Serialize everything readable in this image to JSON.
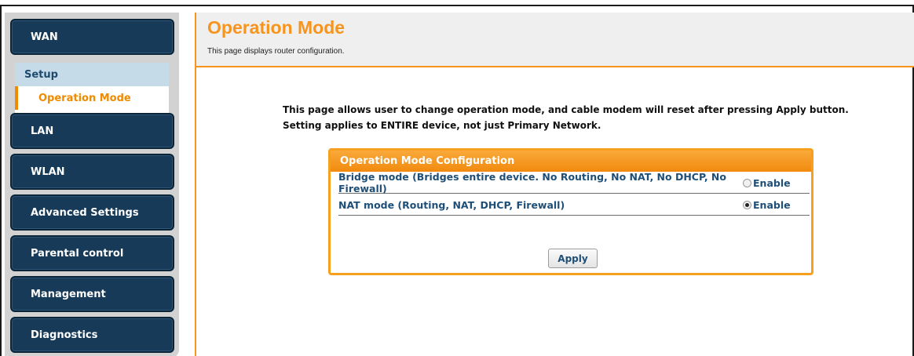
{
  "sidebar": {
    "items": [
      {
        "label": "WAN"
      },
      {
        "label": "LAN"
      },
      {
        "label": "WLAN"
      },
      {
        "label": "Advanced Settings"
      },
      {
        "label": "Parental control"
      },
      {
        "label": "Management"
      },
      {
        "label": "Diagnostics"
      }
    ],
    "submenu": {
      "setup": "Setup",
      "operation_mode": "Operation Mode"
    }
  },
  "header": {
    "title": "Operation Mode",
    "subtitle": "This page displays router configuration."
  },
  "description": {
    "line1": "This page allows user to change operation mode, and cable modem will reset after pressing Apply button.",
    "line2": "Setting applies to ENTIRE device, not just Primary Network."
  },
  "panel": {
    "title": "Operation Mode Configuration",
    "rows": [
      {
        "label": "Bridge mode (Bridges entire device. No Routing, No NAT, No DHCP, No Firewall)",
        "option": "Enable",
        "checked": false
      },
      {
        "label": "NAT mode (Routing, NAT, DHCP, Firewall)",
        "option": "Enable",
        "checked": true
      }
    ],
    "apply_label": "Apply"
  },
  "colors": {
    "accent": "#f7941d",
    "nav": "#163a57",
    "link": "#1e4f78"
  }
}
